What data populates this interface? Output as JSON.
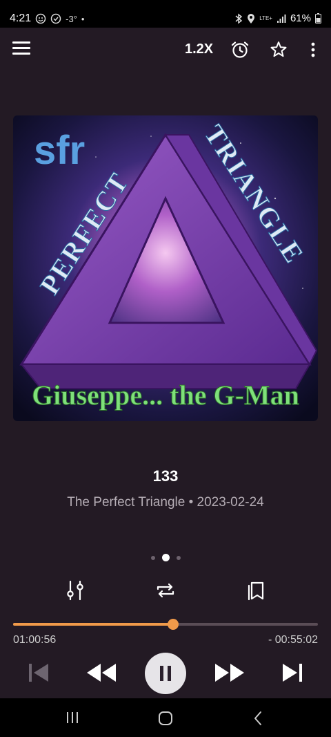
{
  "status_bar": {
    "time": "4:21",
    "left_icons": [
      "emoji-icon",
      "check-circle-icon"
    ],
    "temperature": "-3°",
    "dot": "•",
    "right_icons": [
      "bluetooth-icon",
      "location-icon",
      "lte-icon",
      "signal-icon"
    ],
    "lte_label": "LTE+",
    "battery": "61%"
  },
  "toolbar": {
    "menu_icon": "hamburger-menu-icon",
    "speed": "1.2X",
    "icons": [
      "alarm-clock-icon",
      "star-icon",
      "more-vert-icon"
    ]
  },
  "episode": {
    "title": "133",
    "subtitle": "The Perfect Triangle • 2023-02-24"
  },
  "artwork": {
    "logo": "sfr",
    "banner_left": "PERFECT",
    "banner_right": "TRIANGLE",
    "caption": "Giuseppe... the G-Man",
    "colors": {
      "triangle": "#7a3aa8",
      "caption": "#7ee07a",
      "logo": "#5aa0e0"
    }
  },
  "page_indicator": {
    "count": 3,
    "active": 1
  },
  "controls": {
    "icons": [
      "equalizer-icon",
      "repeat-icon",
      "queue-icon"
    ]
  },
  "progress": {
    "elapsed": "01:00:56",
    "remaining": "- 00:55:02",
    "fraction": 0.525,
    "color": "#f09a4a"
  },
  "playback": {
    "icons": [
      "skip-previous-icon",
      "rewind-icon",
      "pause-icon",
      "fast-forward-icon",
      "skip-next-icon"
    ],
    "skip_previous_disabled": true
  },
  "nav_bar": {
    "icons": [
      "recent-apps-icon",
      "home-icon",
      "back-icon"
    ]
  }
}
